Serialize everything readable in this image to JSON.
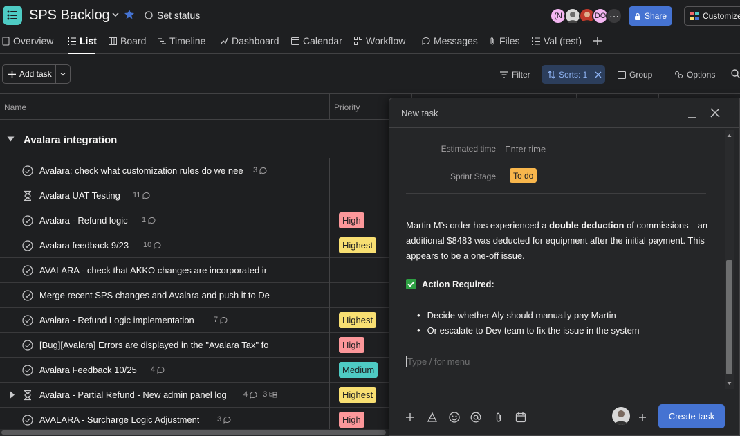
{
  "app": {
    "title": "SPS Backlog",
    "set_status": "Set status",
    "share": "Share",
    "customize": "Customize",
    "avatar_initials": [
      "(N",
      "DO"
    ]
  },
  "tabs": [
    {
      "label": "Overview",
      "icon": "overview-icon"
    },
    {
      "label": "List",
      "icon": "list-icon",
      "active": true
    },
    {
      "label": "Board",
      "icon": "board-icon"
    },
    {
      "label": "Timeline",
      "icon": "timeline-icon"
    },
    {
      "label": "Dashboard",
      "icon": "dashboard-icon"
    },
    {
      "label": "Calendar",
      "icon": "calendar-icon"
    },
    {
      "label": "Workflow",
      "icon": "workflow-icon"
    },
    {
      "label": "Messages",
      "icon": "messages-icon"
    },
    {
      "label": "Files",
      "icon": "files-icon"
    },
    {
      "label": "Val (test)",
      "icon": "list-icon"
    }
  ],
  "toolbar": {
    "add_task": "Add task",
    "filter": "Filter",
    "sorts": "Sorts: 1",
    "group": "Group",
    "options": "Options"
  },
  "table": {
    "columns": [
      "Name",
      "Priority"
    ],
    "section": "Avalara integration",
    "rows": [
      {
        "name": "Avalara: check what customization rules do we nee",
        "comments": "3",
        "priority": "",
        "icon": "check-circle-icon"
      },
      {
        "name": "Avalara UAT Testing",
        "comments": "11",
        "priority": "",
        "icon": "hourglass-icon"
      },
      {
        "name": "Avalara - Refund logic",
        "comments": "1",
        "priority": "High",
        "icon": "check-circle-icon"
      },
      {
        "name": "Avalara feedback 9/23",
        "comments": "10",
        "priority": "Highest",
        "icon": "check-circle-icon"
      },
      {
        "name": "AVALARA - check that AKKO changes are incorporated ir",
        "comments": "",
        "priority": "",
        "icon": "check-circle-icon"
      },
      {
        "name": "Merge recent SPS changes and Avalara and push it to De",
        "comments": "",
        "priority": "",
        "icon": "check-circle-icon"
      },
      {
        "name": "Avalara - Refund Logic implementation",
        "comments": "7",
        "priority": "Highest",
        "icon": "check-circle-icon"
      },
      {
        "name": "[Bug][Avalara] Errors are displayed in the \"Avalara Tax\" fo",
        "comments": "",
        "priority": "High",
        "icon": "check-circle-icon"
      },
      {
        "name": "Avalara Feedback 10/25",
        "comments": "4",
        "priority": "Medium",
        "icon": "check-circle-icon"
      },
      {
        "name": "Avalara - Partial Refund - New admin panel log",
        "comments": "4",
        "subtasks": "3",
        "priority": "Highest",
        "icon": "hourglass-icon",
        "expandable": true
      },
      {
        "name": "AVALARA - Surcharge Logic Adjustment",
        "comments": "3",
        "priority": "High",
        "icon": "check-circle-icon"
      }
    ]
  },
  "modal": {
    "title": "New task",
    "estimated_time_label": "Estimated time",
    "estimated_time_placeholder": "Enter time",
    "sprint_stage_label": "Sprint Stage",
    "sprint_stage_value": "To do",
    "desc_part1": "Martin M’s order has experienced a ",
    "desc_bold": "double deduction",
    "desc_part2": " of commissions—an additional $8483 was deducted for equipment after the initial payment. This appears to be a one-off issue.",
    "action_label": "Action Required:",
    "bullets": [
      "Decide whether Aly should manually pay Martin",
      "Or escalate to Dev team to fix the issue in the system"
    ],
    "editor_placeholder": "Type / for menu",
    "create_button": "Create task"
  },
  "colors": {
    "accent": "#4573d2",
    "high": "#fc979a",
    "highest": "#f8df72",
    "medium": "#4ecbc4",
    "todo": "#f8b64c"
  }
}
